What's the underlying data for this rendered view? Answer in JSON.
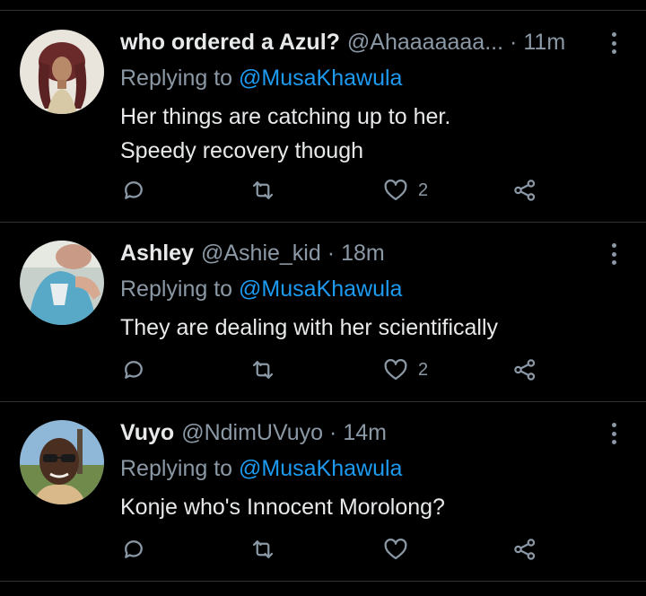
{
  "replying_prefix": "Replying to",
  "tweets": [
    {
      "name": "who ordered a Azul?",
      "handle": "@Ahaaaaaaa...",
      "time": "11m",
      "mention": "@MusaKhawula",
      "text_lines": [
        "Her things are catching up to her.",
        "Speedy recovery though"
      ],
      "like_count": "2",
      "avatar_icon": "avatar-woman-braids"
    },
    {
      "name": "Ashley",
      "handle": "@Ashie_kid",
      "time": "18m",
      "mention": "@MusaKhawula",
      "text_lines": [
        "They are dealing with her scientifically"
      ],
      "like_count": "2",
      "avatar_icon": "avatar-person-blue-shirt"
    },
    {
      "name": "Vuyo",
      "handle": "@NdimUVuyo",
      "time": "14m",
      "mention": "@MusaKhawula",
      "text_lines": [
        "Konje who's Innocent Morolong?"
      ],
      "like_count": "",
      "avatar_icon": "avatar-man-glasses"
    }
  ],
  "colors": {
    "background": "#000000",
    "text": "#e7e9ea",
    "secondary": "#8b98a5",
    "link": "#1d9bf0",
    "divider": "#2f3336"
  }
}
